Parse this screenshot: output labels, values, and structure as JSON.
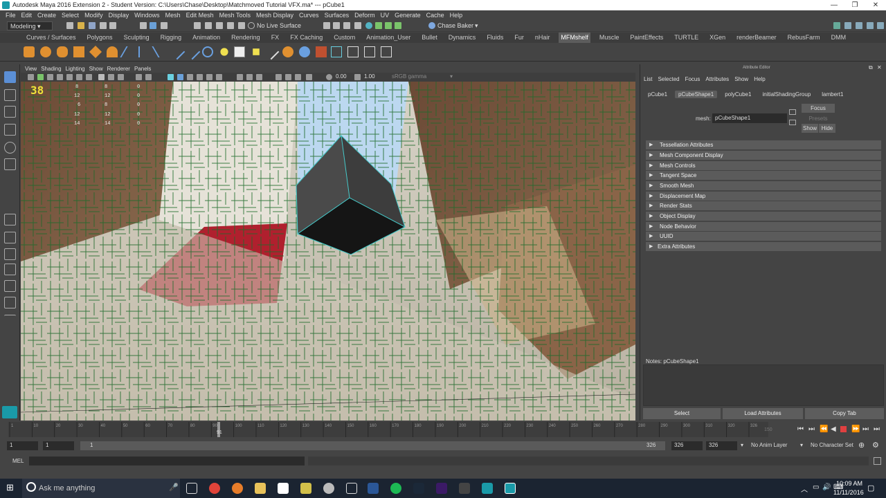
{
  "window": {
    "title": "Autodesk Maya 2016 Extension 2 - Student Version: C:\\Users\\Chase\\Desktop\\Matchmoved Tutorial VFX.ma*   ---   pCube1"
  },
  "menubar": [
    "File",
    "Edit",
    "Create",
    "Select",
    "Modify",
    "Display",
    "Windows",
    "Mesh",
    "Edit Mesh",
    "Mesh Tools",
    "Mesh Display",
    "Curves",
    "Surfaces",
    "Deform",
    "UV",
    "Generate",
    "Cache",
    "Help"
  ],
  "statusline": {
    "mode": "Modeling",
    "live_surface": "No Live Surface",
    "user": "Chase Baker"
  },
  "shelf_tabs": [
    "Curves / Surfaces",
    "Polygons",
    "Sculpting",
    "Rigging",
    "Animation",
    "Rendering",
    "FX",
    "FX Caching",
    "Custom",
    "Animation_User",
    "Bullet",
    "Dynamics",
    "Fluids",
    "Fur",
    "nHair",
    "MFMshelf",
    "Muscle",
    "PaintEffects",
    "TURTLE",
    "XGen",
    "renderBeamer",
    "RebusFarm",
    "DMM"
  ],
  "shelf_active": "MFMshelf",
  "viewport": {
    "menu": [
      "View",
      "Shading",
      "Lighting",
      "Show",
      "Renderer",
      "Panels"
    ],
    "exposure": "0.00",
    "gamma": "1.00",
    "colorspace": "sRGB gamma",
    "frame_counter": "38",
    "hud_rows": [
      [
        "8",
        "8",
        "0"
      ],
      [
        "12",
        "12",
        "0"
      ],
      [
        "6",
        "8",
        "0"
      ],
      [
        "12",
        "12",
        "0"
      ],
      [
        "14",
        "14",
        "0"
      ]
    ]
  },
  "attribute_editor": {
    "title": "Attribute Editor",
    "menu": [
      "List",
      "Selected",
      "Focus",
      "Attributes",
      "Show",
      "Help"
    ],
    "tabs": [
      "pCube1",
      "pCubeShape1",
      "polyCube1",
      "initialShadingGroup",
      "lambert1"
    ],
    "active_tab": "pCubeShape1",
    "mesh_label": "mesh:",
    "mesh_value": "pCubeShape1",
    "focus": "Focus",
    "presets": "Presets",
    "show": "Show",
    "hide": "Hide",
    "sections": [
      "Tessellation Attributes",
      "Mesh Component Display",
      "Mesh Controls",
      "Tangent Space",
      "Smooth Mesh",
      "Displacement Map",
      "Render Stats",
      "Object Display",
      "Node Behavior",
      "UUID",
      "Extra Attributes"
    ],
    "notes": "Notes:  pCubeShape1",
    "buttons": [
      "Select",
      "Load Attributes",
      "Copy Tab"
    ]
  },
  "timeline": {
    "ticks": [
      "1",
      "10",
      "20",
      "30",
      "40",
      "50",
      "60",
      "70",
      "80",
      "90",
      "100",
      "110",
      "120",
      "130",
      "140",
      "150",
      "160",
      "170",
      "180",
      "190",
      "200",
      "210",
      "220",
      "230",
      "240",
      "250",
      "260",
      "270",
      "280",
      "290",
      "300",
      "310",
      "320",
      "326"
    ],
    "current": "91",
    "range_max": "150"
  },
  "range": {
    "start": "1",
    "start2": "1",
    "thumb": "1",
    "end_thumb": "326",
    "end": "326",
    "end2": "326",
    "anim_layer": "No Anim Layer",
    "char_set": "No Character Set"
  },
  "cmd": {
    "label": "MEL"
  },
  "taskbar": {
    "search": "Ask me anything",
    "time": "10:09 AM",
    "date": "11/11/2016"
  }
}
